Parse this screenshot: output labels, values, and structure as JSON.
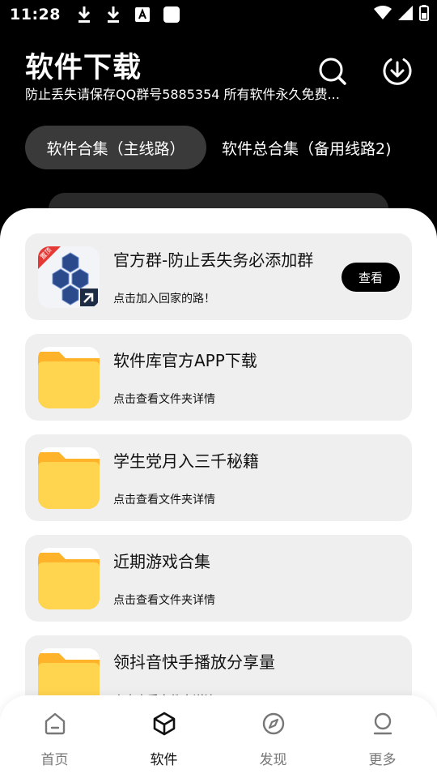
{
  "status_bar": {
    "time": "11:28",
    "left_icons": [
      "download-icon",
      "download-icon",
      "font-a-icon",
      "square-icon"
    ],
    "right_icons": [
      "wifi-icon",
      "signal-icon",
      "battery-icon"
    ]
  },
  "header": {
    "title": "软件下载",
    "subtitle": "防止丢失请保存QQ群号5885354 所有软件永久免费...",
    "actions": [
      "search-icon",
      "download-circle-icon"
    ]
  },
  "tabs": [
    {
      "label": "软件合集（主线路）",
      "active": true
    },
    {
      "label": "软件总合集（备用线路2)",
      "active": false
    }
  ],
  "items": [
    {
      "title": "官方群-防止丢失务必添加群",
      "subtitle": "点击加入回家的路！",
      "icon": "app-icon",
      "badge": "置顶",
      "button": "查看"
    },
    {
      "title": "软件库官方APP下载",
      "subtitle": "点击查看文件夹详情",
      "icon": "folder-icon"
    },
    {
      "title": "学生党月入三千秘籍",
      "subtitle": "点击查看文件夹详情",
      "icon": "folder-icon"
    },
    {
      "title": "近期游戏合集",
      "subtitle": "点击查看文件夹详情",
      "icon": "folder-icon"
    },
    {
      "title": "领抖音快手播放分享量",
      "subtitle": "点击查看文件夹详情",
      "icon": "folder-icon"
    }
  ],
  "bottom_nav": [
    {
      "label": "首页",
      "icon": "home-icon",
      "active": false
    },
    {
      "label": "软件",
      "icon": "box-icon",
      "active": true
    },
    {
      "label": "发现",
      "icon": "compass-icon",
      "active": false
    },
    {
      "label": "更多",
      "icon": "user-icon",
      "active": false
    }
  ],
  "colors": {
    "background": "#000000",
    "sheet": "#ffffff",
    "card": "#efefef",
    "folder": "#FFD54F",
    "folder_tab": "#FFB32A",
    "badge": "#E53935",
    "app_icon_hex": "#2B4A8C"
  }
}
